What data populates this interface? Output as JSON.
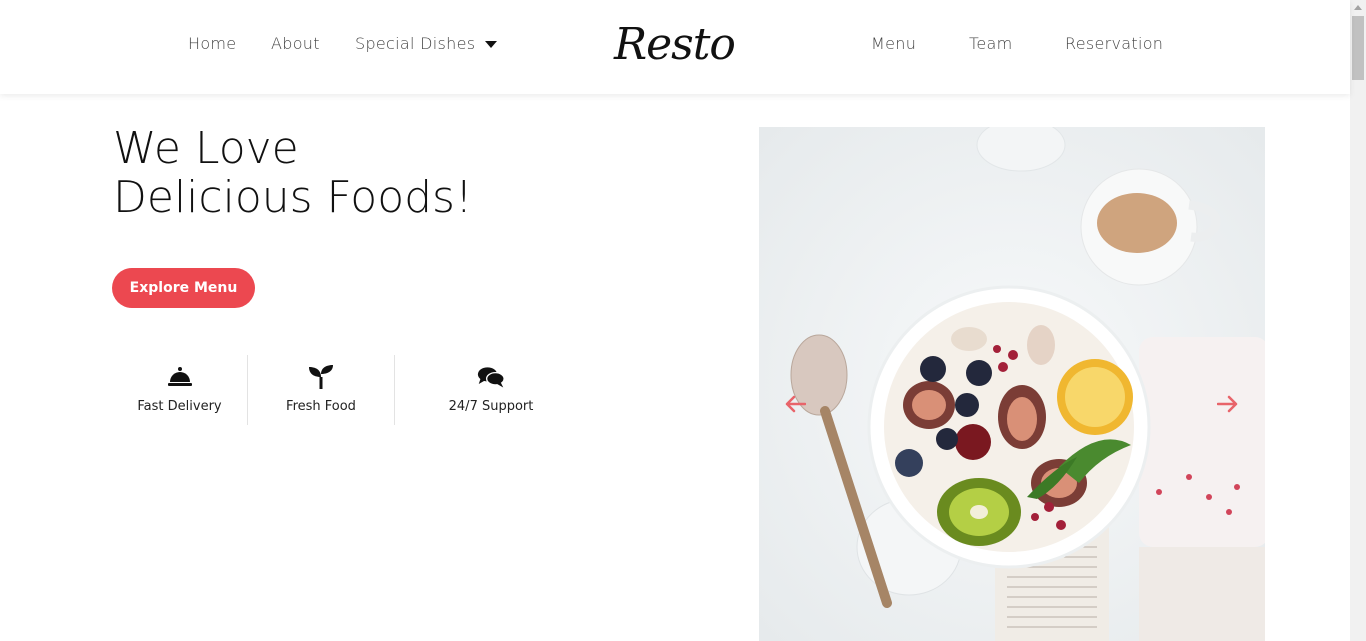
{
  "header": {
    "logo": "Resto",
    "nav_left": [
      "Home",
      "About",
      "Special Dishes"
    ],
    "nav_right": [
      "Menu",
      "Team",
      "Reservation"
    ]
  },
  "hero": {
    "title_line1": "We Love",
    "title_line2": "Delicious Foods!",
    "cta_label": "Explore Menu"
  },
  "features": [
    {
      "label": "Fast Delivery",
      "icon": "bell-icon"
    },
    {
      "label": "Fresh Food",
      "icon": "sprout-icon"
    },
    {
      "label": "24/7 Support",
      "icon": "comments-icon"
    }
  ],
  "carousel": {
    "prev_icon": "arrow-left-icon",
    "next_icon": "arrow-right-icon"
  },
  "colors": {
    "accent": "#ec4850",
    "arrow": "#e8646a"
  }
}
